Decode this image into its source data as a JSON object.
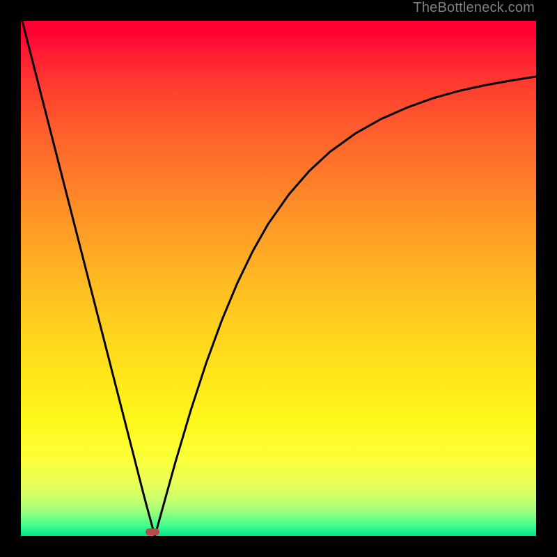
{
  "watermark": "TheBottleneck.com",
  "marker": {
    "x_frac": 0.255,
    "y_frac": 0.992
  },
  "chart_data": {
    "type": "line",
    "title": "",
    "xlabel": "",
    "ylabel": "",
    "xlim": [
      0,
      1
    ],
    "ylim": [
      0,
      1
    ],
    "series": [
      {
        "name": "curve",
        "x": [
          0.0,
          0.03,
          0.06,
          0.09,
          0.12,
          0.15,
          0.18,
          0.21,
          0.24,
          0.26,
          0.28,
          0.3,
          0.33,
          0.36,
          0.39,
          0.42,
          0.45,
          0.48,
          0.52,
          0.56,
          0.6,
          0.65,
          0.7,
          0.75,
          0.8,
          0.85,
          0.9,
          0.95,
          1.0
        ],
        "y": [
          1.01,
          0.893,
          0.776,
          0.659,
          0.542,
          0.425,
          0.308,
          0.191,
          0.074,
          0.0,
          0.072,
          0.144,
          0.245,
          0.337,
          0.419,
          0.491,
          0.553,
          0.606,
          0.663,
          0.709,
          0.746,
          0.782,
          0.81,
          0.832,
          0.85,
          0.864,
          0.875,
          0.884,
          0.892
        ]
      }
    ],
    "marker": {
      "x": 0.255,
      "y": 0.008
    },
    "background_gradient": {
      "top_color": "#ff0033",
      "bottom_color": "#00e28a"
    }
  }
}
